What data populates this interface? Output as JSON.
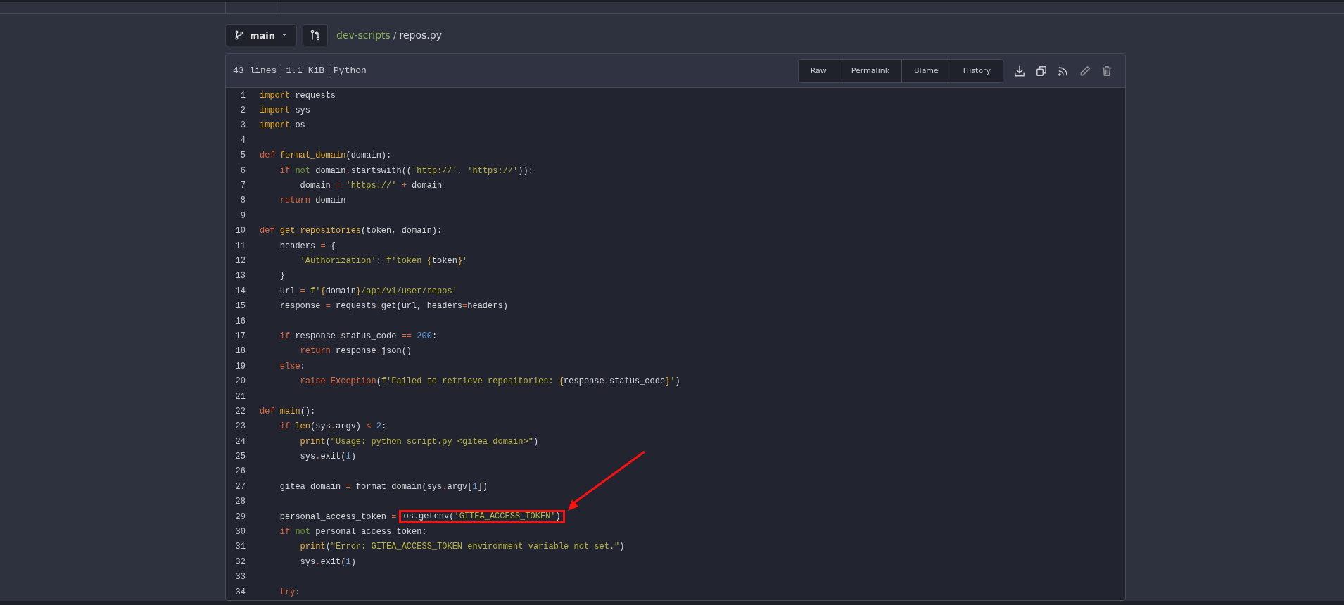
{
  "branch": {
    "name": "main"
  },
  "breadcrumb": {
    "repo": "dev-scripts",
    "separator": "/",
    "file": "repos.py"
  },
  "file_info": [
    "43 lines",
    "1.1 KiB",
    "Python"
  ],
  "file_buttons": [
    "Raw",
    "Permalink",
    "Blame",
    "History"
  ],
  "code_lines": [
    {
      "number": "1",
      "tokens": [
        {
          "kind": "import",
          "text": "import"
        },
        {
          "kind": "plain",
          "text": " requests"
        }
      ]
    },
    {
      "number": "2",
      "tokens": [
        {
          "kind": "import",
          "text": "import"
        },
        {
          "kind": "plain",
          "text": " sys"
        }
      ]
    },
    {
      "number": "3",
      "tokens": [
        {
          "kind": "import",
          "text": "import"
        },
        {
          "kind": "plain",
          "text": " os"
        }
      ]
    },
    {
      "number": "4"
    },
    {
      "number": "5",
      "tokens": [
        {
          "kind": "keyword",
          "text": "def "
        },
        {
          "kind": "function",
          "text": "format_domain"
        },
        {
          "kind": "plain",
          "text": "(domain):"
        }
      ]
    },
    {
      "number": "6",
      "tokens": [
        {
          "kind": "keyword",
          "text": "    if "
        },
        {
          "kind": "wordop",
          "text": "not"
        },
        {
          "kind": "plain",
          "text": " domain"
        },
        {
          "kind": "op",
          "text": "."
        },
        {
          "kind": "plain",
          "text": "startswith(("
        },
        {
          "kind": "string",
          "text": "'http://'"
        },
        {
          "kind": "plain",
          "text": ", "
        },
        {
          "kind": "string",
          "text": "'https://'"
        },
        {
          "kind": "plain",
          "text": ")):"
        }
      ]
    },
    {
      "number": "7",
      "tokens": [
        {
          "kind": "plain",
          "text": "        domain "
        },
        {
          "kind": "op",
          "text": "= "
        },
        {
          "kind": "string",
          "text": "'https://' "
        },
        {
          "kind": "op",
          "text": "+"
        },
        {
          "kind": "plain",
          "text": " domain"
        }
      ]
    },
    {
      "number": "8",
      "tokens": [
        {
          "kind": "keyword",
          "text": "    return"
        },
        {
          "kind": "plain",
          "text": " domain"
        }
      ]
    },
    {
      "number": "9"
    },
    {
      "number": "10",
      "tokens": [
        {
          "kind": "keyword",
          "text": "def "
        },
        {
          "kind": "function",
          "text": "get_repositories"
        },
        {
          "kind": "plain",
          "text": "(token, domain):"
        }
      ]
    },
    {
      "number": "11",
      "tokens": [
        {
          "kind": "plain",
          "text": "    headers "
        },
        {
          "kind": "op",
          "text": "="
        },
        {
          "kind": "plain",
          "text": " {"
        }
      ]
    },
    {
      "number": "12",
      "tokens": [
        {
          "kind": "string",
          "text": "        'Authorization'"
        },
        {
          "kind": "plain",
          "text": ": "
        },
        {
          "kind": "string",
          "text": "f'token "
        },
        {
          "kind": "builtin",
          "text": "{"
        },
        {
          "kind": "plain",
          "text": "token"
        },
        {
          "kind": "builtin",
          "text": "}"
        },
        {
          "kind": "string",
          "text": "'"
        }
      ]
    },
    {
      "number": "13",
      "tokens": [
        {
          "kind": "plain",
          "text": "    }"
        }
      ]
    },
    {
      "number": "14",
      "tokens": [
        {
          "kind": "plain",
          "text": "    url "
        },
        {
          "kind": "op",
          "text": "= "
        },
        {
          "kind": "string",
          "text": "f'"
        },
        {
          "kind": "builtin",
          "text": "{"
        },
        {
          "kind": "plain",
          "text": "domain"
        },
        {
          "kind": "builtin",
          "text": "}"
        },
        {
          "kind": "string",
          "text": "/api/v1/user/repos'"
        }
      ]
    },
    {
      "number": "15",
      "tokens": [
        {
          "kind": "plain",
          "text": "    response "
        },
        {
          "kind": "op",
          "text": "="
        },
        {
          "kind": "plain",
          "text": " requests"
        },
        {
          "kind": "op",
          "text": "."
        },
        {
          "kind": "plain",
          "text": "get(url, headers"
        },
        {
          "kind": "op",
          "text": "="
        },
        {
          "kind": "plain",
          "text": "headers)"
        }
      ]
    },
    {
      "number": "16"
    },
    {
      "number": "17",
      "tokens": [
        {
          "kind": "keyword",
          "text": "    if"
        },
        {
          "kind": "plain",
          "text": " response"
        },
        {
          "kind": "op",
          "text": "."
        },
        {
          "kind": "plain",
          "text": "status_code "
        },
        {
          "kind": "op",
          "text": "== "
        },
        {
          "kind": "number",
          "text": "200"
        },
        {
          "kind": "plain",
          "text": ":"
        }
      ]
    },
    {
      "number": "18",
      "tokens": [
        {
          "kind": "keyword",
          "text": "        return"
        },
        {
          "kind": "plain",
          "text": " response"
        },
        {
          "kind": "op",
          "text": "."
        },
        {
          "kind": "plain",
          "text": "json()"
        }
      ]
    },
    {
      "number": "19",
      "tokens": [
        {
          "kind": "keyword",
          "text": "    else"
        },
        {
          "kind": "plain",
          "text": ":"
        }
      ]
    },
    {
      "number": "20",
      "tokens": [
        {
          "kind": "keyword",
          "text": "        raise Exception"
        },
        {
          "kind": "plain",
          "text": "("
        },
        {
          "kind": "string",
          "text": "f'Failed to retrieve repositories: "
        },
        {
          "kind": "builtin",
          "text": "{"
        },
        {
          "kind": "plain",
          "text": "response"
        },
        {
          "kind": "op",
          "text": "."
        },
        {
          "kind": "plain",
          "text": "status_code"
        },
        {
          "kind": "builtin",
          "text": "}"
        },
        {
          "kind": "string",
          "text": "'"
        },
        {
          "kind": "plain",
          "text": ")"
        }
      ]
    },
    {
      "number": "21"
    },
    {
      "number": "22",
      "tokens": [
        {
          "kind": "keyword",
          "text": "def "
        },
        {
          "kind": "function",
          "text": "main"
        },
        {
          "kind": "plain",
          "text": "():"
        }
      ]
    },
    {
      "number": "23",
      "tokens": [
        {
          "kind": "keyword",
          "text": "    if "
        },
        {
          "kind": "builtin",
          "text": "len"
        },
        {
          "kind": "plain",
          "text": "(sys"
        },
        {
          "kind": "op",
          "text": "."
        },
        {
          "kind": "plain",
          "text": "argv) "
        },
        {
          "kind": "op",
          "text": "< "
        },
        {
          "kind": "number",
          "text": "2"
        },
        {
          "kind": "plain",
          "text": ":"
        }
      ]
    },
    {
      "number": "24",
      "tokens": [
        {
          "kind": "builtin",
          "text": "        print"
        },
        {
          "kind": "plain",
          "text": "("
        },
        {
          "kind": "string",
          "text": "\"Usage: python script.py <gitea_domain>\""
        },
        {
          "kind": "plain",
          "text": ")"
        }
      ]
    },
    {
      "number": "25",
      "tokens": [
        {
          "kind": "plain",
          "text": "        sys"
        },
        {
          "kind": "op",
          "text": "."
        },
        {
          "kind": "plain",
          "text": "exit("
        },
        {
          "kind": "number",
          "text": "1"
        },
        {
          "kind": "plain",
          "text": ")"
        }
      ]
    },
    {
      "number": "26"
    },
    {
      "number": "27",
      "tokens": [
        {
          "kind": "plain",
          "text": "    gitea_domain "
        },
        {
          "kind": "op",
          "text": "="
        },
        {
          "kind": "plain",
          "text": " format_domain(sys"
        },
        {
          "kind": "op",
          "text": "."
        },
        {
          "kind": "plain",
          "text": "argv["
        },
        {
          "kind": "number",
          "text": "1"
        },
        {
          "kind": "plain",
          "text": "])"
        }
      ]
    },
    {
      "number": "28"
    },
    {
      "number": "29",
      "tokens": [
        {
          "kind": "plain",
          "text": "    personal_access_token "
        },
        {
          "kind": "op",
          "text": "="
        },
        {
          "kind": "highlight",
          "arrow": true,
          "tokens": [
            {
              "kind": "plain",
              "text": "os"
            },
            {
              "kind": "op",
              "text": "."
            },
            {
              "kind": "plain",
              "text": "getenv("
            },
            {
              "kind": "string",
              "text": "'GITEA_ACCESS_TOKEN'"
            },
            {
              "kind": "plain",
              "text": ")"
            }
          ]
        }
      ]
    },
    {
      "number": "30",
      "tokens": [
        {
          "kind": "keyword",
          "text": "    if "
        },
        {
          "kind": "wordop",
          "text": "not"
        },
        {
          "kind": "plain",
          "text": " personal_access_token:"
        }
      ]
    },
    {
      "number": "31",
      "tokens": [
        {
          "kind": "builtin",
          "text": "        print"
        },
        {
          "kind": "plain",
          "text": "("
        },
        {
          "kind": "string",
          "text": "\"Error: GITEA_ACCESS_TOKEN environment variable not set.\""
        },
        {
          "kind": "plain",
          "text": ")"
        }
      ]
    },
    {
      "number": "32",
      "tokens": [
        {
          "kind": "plain",
          "text": "        sys"
        },
        {
          "kind": "op",
          "text": "."
        },
        {
          "kind": "plain",
          "text": "exit("
        },
        {
          "kind": "number",
          "text": "1"
        },
        {
          "kind": "plain",
          "text": ")"
        }
      ]
    },
    {
      "number": "33"
    },
    {
      "number": "34",
      "tokens": [
        {
          "kind": "keyword",
          "text": "    try"
        },
        {
          "kind": "plain",
          "text": ":"
        }
      ]
    }
  ]
}
